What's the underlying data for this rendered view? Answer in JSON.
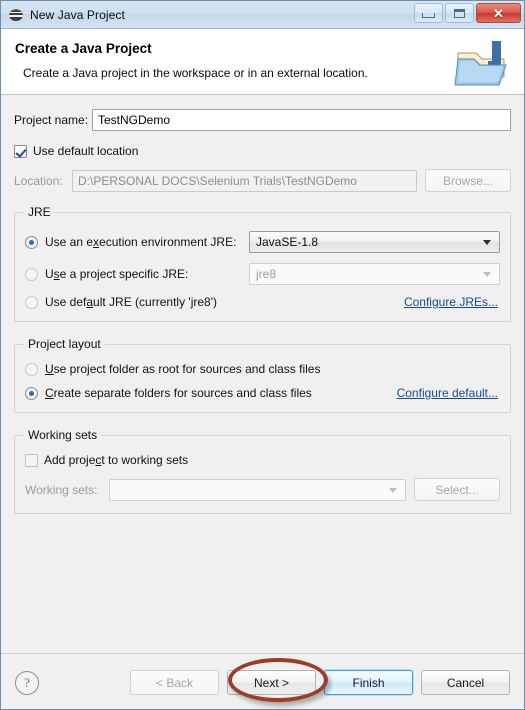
{
  "window": {
    "title": "New Java Project",
    "title_icon": "java-globe-icon",
    "buttons": {
      "minimize": "minimize-icon",
      "maximize": "maximize-icon",
      "close": "✕"
    }
  },
  "header": {
    "title": "Create a Java Project",
    "subtitle": "Create a Java project in the workspace or in an external location.",
    "icon": "new-java-project-folder-icon"
  },
  "form": {
    "project_name_label": "Project name:",
    "project_name_value": "TestNGDemo",
    "project_name_placeholder": "",
    "use_default_location_label": "Use default location",
    "use_default_location_checked": true,
    "location_label": "Location:",
    "location_value": "D:\\PERSONAL DOCS\\Selenium Trials\\TestNGDemo",
    "browse_label": "Browse..."
  },
  "jre": {
    "group_title": "JRE",
    "options": [
      {
        "label_pre": "Use an e",
        "label_mnemonic": "x",
        "label_post": "ecution environment JRE:",
        "selected": true,
        "value": "JavaSE-1.8",
        "enabled": true
      },
      {
        "label_pre": "U",
        "label_mnemonic": "s",
        "label_post": "e a project specific JRE:",
        "selected": false,
        "value": "jre8",
        "enabled": false
      },
      {
        "label_pre": "Use def",
        "label_mnemonic": "a",
        "label_post": "ult JRE (currently 'jre8')",
        "selected": false,
        "value": "",
        "enabled": false
      }
    ],
    "configure_link": "Configure JREs..."
  },
  "layout": {
    "group_title": "Project layout",
    "options": [
      {
        "label_pre": "",
        "label_mnemonic": "U",
        "label_post": "se project folder as root for sources and class files",
        "selected": false
      },
      {
        "label_pre": "",
        "label_mnemonic": "C",
        "label_post": "reate separate folders for sources and class files",
        "selected": true
      }
    ],
    "configure_link": "Configure default..."
  },
  "working_sets": {
    "group_title": "Working sets",
    "add_label_pre": "Add proje",
    "add_label_mnemonic": "c",
    "add_label_post": "t to working sets",
    "add_checked": false,
    "sets_label": "Working sets:",
    "sets_value": "",
    "select_label": "Select..."
  },
  "footer": {
    "help_icon": "?",
    "back_label": "< Back",
    "next_label": "Next >",
    "finish_label": "Finish",
    "cancel_label": "Cancel",
    "back_enabled": false,
    "highlight_color": "#9d3b2c"
  }
}
